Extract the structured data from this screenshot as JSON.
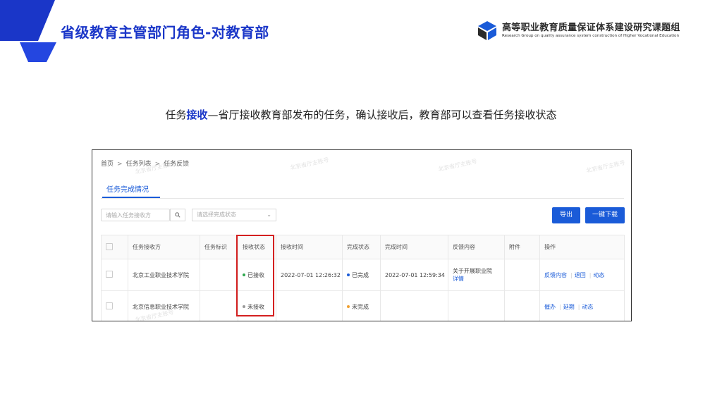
{
  "slide": {
    "title": "省级教育主管部门角色-对教育部",
    "logo_cn": "高等职业教育质量保证体系建设研究课题组",
    "logo_en": "Research Group on quality assurance system construction of Higher Vocational Education",
    "subtitle_before": "任务",
    "subtitle_highlight": "接收",
    "subtitle_after": "—省厅接收教育部发布的任务，确认接收后，教育部可以查看任务接收状态",
    "accent_color": "#1a36c8"
  },
  "screen": {
    "breadcrumb": [
      "首页",
      "任务列表",
      "任务反馈"
    ],
    "breadcrumb_separator": ">",
    "tab": "任务完成情况",
    "search_placeholder": "请输入任务接收方",
    "search_icon": "search-icon",
    "status_filter_placeholder": "请选择完成状态",
    "export_label": "导出",
    "download_label": "一键下载",
    "watermark": "北京省厅主账号",
    "columns": [
      "任务接收方",
      "任务标识",
      "接收状态",
      "接收时间",
      "完成状态",
      "完成时间",
      "反馈内容",
      "附件",
      "操作"
    ],
    "rows": [
      {
        "receiver": "北京工业职业技术学院",
        "task_id": "",
        "receive_status": "已接收",
        "receive_status_color": "#2fa84f",
        "receive_time": "2022-07-01 12:26:32",
        "complete_status": "已完成",
        "complete_status_color": "#1a5bd8",
        "complete_time": "2022-07-01 12:59:34",
        "feedback": "关于开展职业院",
        "feedback_link": "详情",
        "attachment": "",
        "actions": [
          "反馈内容",
          "退回",
          "动态"
        ]
      },
      {
        "receiver": "北京信息职业技术学院",
        "task_id": "",
        "receive_status": "未接收",
        "receive_status_color": "#999999",
        "receive_time": "",
        "complete_status": "未完成",
        "complete_status_color": "#f0a030",
        "complete_time": "",
        "feedback": "",
        "feedback_link": "",
        "attachment": "",
        "actions": [
          "催办",
          "延期",
          "动态"
        ]
      }
    ]
  }
}
